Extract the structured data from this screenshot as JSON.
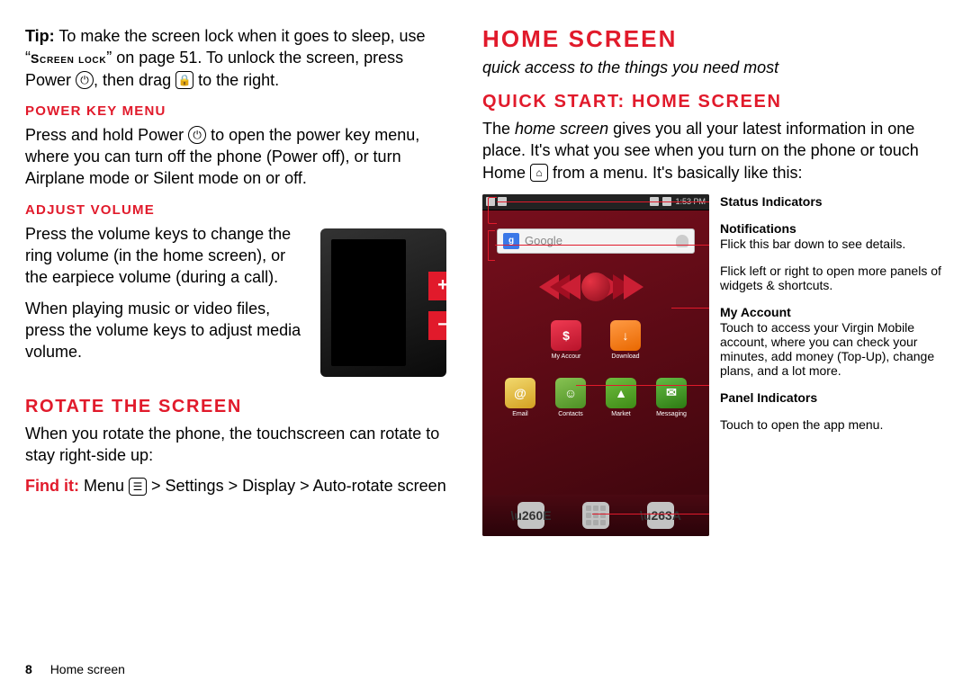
{
  "left": {
    "tip_label": "Tip:",
    "tip_text1": " To make the screen lock when it goes to sleep, use “",
    "screen_lock": "Screen lock",
    "tip_text2": "” on page 51. To unlock the screen, press Power ",
    "power_icon": "⏻",
    "tip_text3": ", then drag ",
    "lock_icon": "🔒",
    "tip_text4": " to the right.",
    "power_menu_heading": "Power key menu",
    "power_menu_text1": "Press and hold Power ",
    "power_menu_text2": " to open the power key menu, where you can turn off the phone (Power off), or turn Airplane mode or Silent mode on or off.",
    "adjust_volume_heading": "Adjust volume",
    "adjust_volume_p1": "Press the volume keys to change the ring volume (in the home screen), or the earpiece volume (during a call).",
    "adjust_volume_p2": "When playing music or video files, press the volume keys to adjust media volume.",
    "rotate_heading": "Rotate the screen",
    "rotate_p1": "When you rotate the phone, the touchscreen can rotate to stay right-side up:",
    "findit_label": "Find it:",
    "findit_text": " Menu ",
    "menu_icon": "☰",
    "findit_path": " > Settings > Display > Auto-rotate screen",
    "page_num": "8",
    "page_section": "Home screen"
  },
  "right": {
    "title": "Home screen",
    "subtitle": "quick access to the things you need most",
    "quickstart_heading": "Quick start: Home screen",
    "intro_text1": "The ",
    "intro_em": "home screen",
    "intro_text2": " gives you all your latest information in one place. It's what you see when you turn on the phone or touch Home ",
    "home_icon": "⌂",
    "intro_text3": " from a menu. It's basically like this:",
    "status_time": "1:53 PM",
    "search_placeholder": "Google",
    "apps_row1": [
      {
        "label": "My Accour",
        "class": "myacct",
        "glyph": "$"
      },
      {
        "label": "Download",
        "class": "dload",
        "glyph": "↓"
      }
    ],
    "apps_row2": [
      {
        "label": "Email",
        "class": "email",
        "glyph": "@"
      },
      {
        "label": "Contacts",
        "class": "contacts",
        "glyph": "☺"
      },
      {
        "label": "Market",
        "class": "market",
        "glyph": "▲"
      },
      {
        "label": "Messaging",
        "class": "msg",
        "glyph": "✉"
      }
    ],
    "callouts": {
      "status": {
        "title": "Status Indicators"
      },
      "notif": {
        "title": "Notifications",
        "text": "Flick this bar down to see details."
      },
      "swipe": {
        "text": "Flick left or right to open more panels of widgets & shortcuts."
      },
      "myacct": {
        "title": "My Account",
        "text": "Touch to access your Virgin Mobile account, where you can check your minutes, add money (Top-Up), change plans, and a lot more."
      },
      "panel": {
        "title": "Panel Indicators"
      },
      "appmenu": {
        "text": "Touch to open the app menu."
      }
    }
  }
}
